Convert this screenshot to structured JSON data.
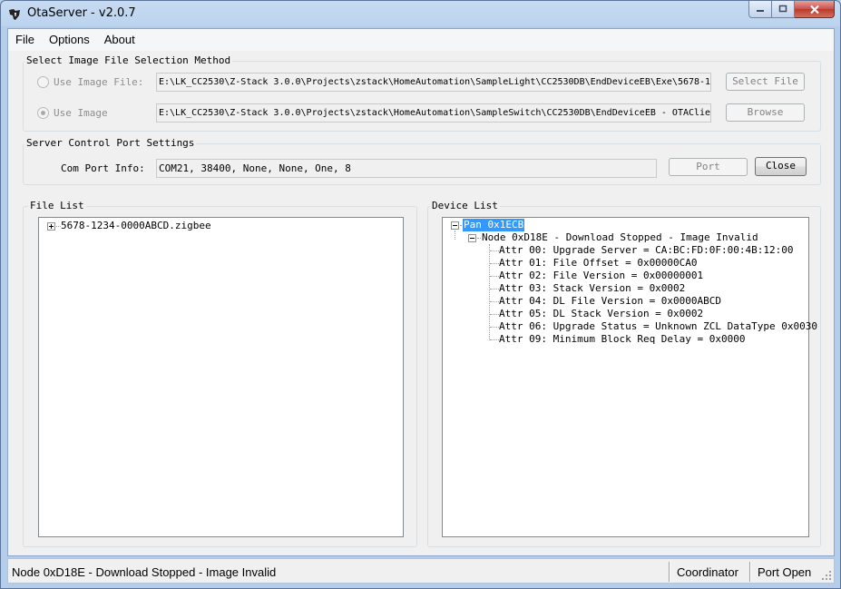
{
  "window": {
    "title": "OtaServer - v2.0.7"
  },
  "menu": {
    "items": [
      "File",
      "Options",
      "About"
    ]
  },
  "image_selection": {
    "title": "Select Image File Selection Method",
    "use_image_file_label": "Use Image File:",
    "use_image_file_path": "E:\\LK_CC2530\\Z-Stack 3.0.0\\Projects\\zstack\\HomeAutomation\\SampleLight\\CC2530DB\\EndDeviceEB\\Exe\\5678-1",
    "select_file_label": "Select File",
    "use_image_label": "Use Image",
    "use_image_path": "E:\\LK_CC2530\\Z-Stack 3.0.0\\Projects\\zstack\\HomeAutomation\\SampleSwitch\\CC2530DB\\EndDeviceEB - OTAClie",
    "browse_label": "Browse"
  },
  "server_control": {
    "title": "Server Control Port Settings",
    "com_port_label": "Com Port Info:",
    "com_port_value": "COM21, 38400, None, None, One, 8",
    "port_label": "Port",
    "close_label": "Close"
  },
  "file_list": {
    "title": "File List",
    "items": [
      "5678-1234-0000ABCD.zigbee"
    ]
  },
  "device_list": {
    "title": "Device List",
    "pan": "Pan 0x1ECB",
    "node": "Node 0xD18E - Download Stopped - Image Invalid",
    "attrs": [
      "Attr 00: Upgrade Server = CA:BC:FD:0F:00:4B:12:00",
      "Attr 01: File Offset = 0x00000CA0",
      "Attr 02: File Version = 0x00000001",
      "Attr 03: Stack Version = 0x0002",
      "Attr 04: DL File Version = 0x0000ABCD",
      "Attr 05: DL Stack Version = 0x0002",
      "Attr 06: Upgrade Status = Unknown ZCL DataType 0x0030",
      "Attr 09: Minimum Block Req Delay = 0x0000"
    ]
  },
  "status_bar": {
    "message": "Node 0xD18E - Download Stopped - Image Invalid",
    "role": "Coordinator",
    "port_state": "Port Open"
  },
  "colors": {
    "selection": "#3399ff",
    "close_button": "#c75050",
    "title_gradient": "#bcd3ee"
  }
}
